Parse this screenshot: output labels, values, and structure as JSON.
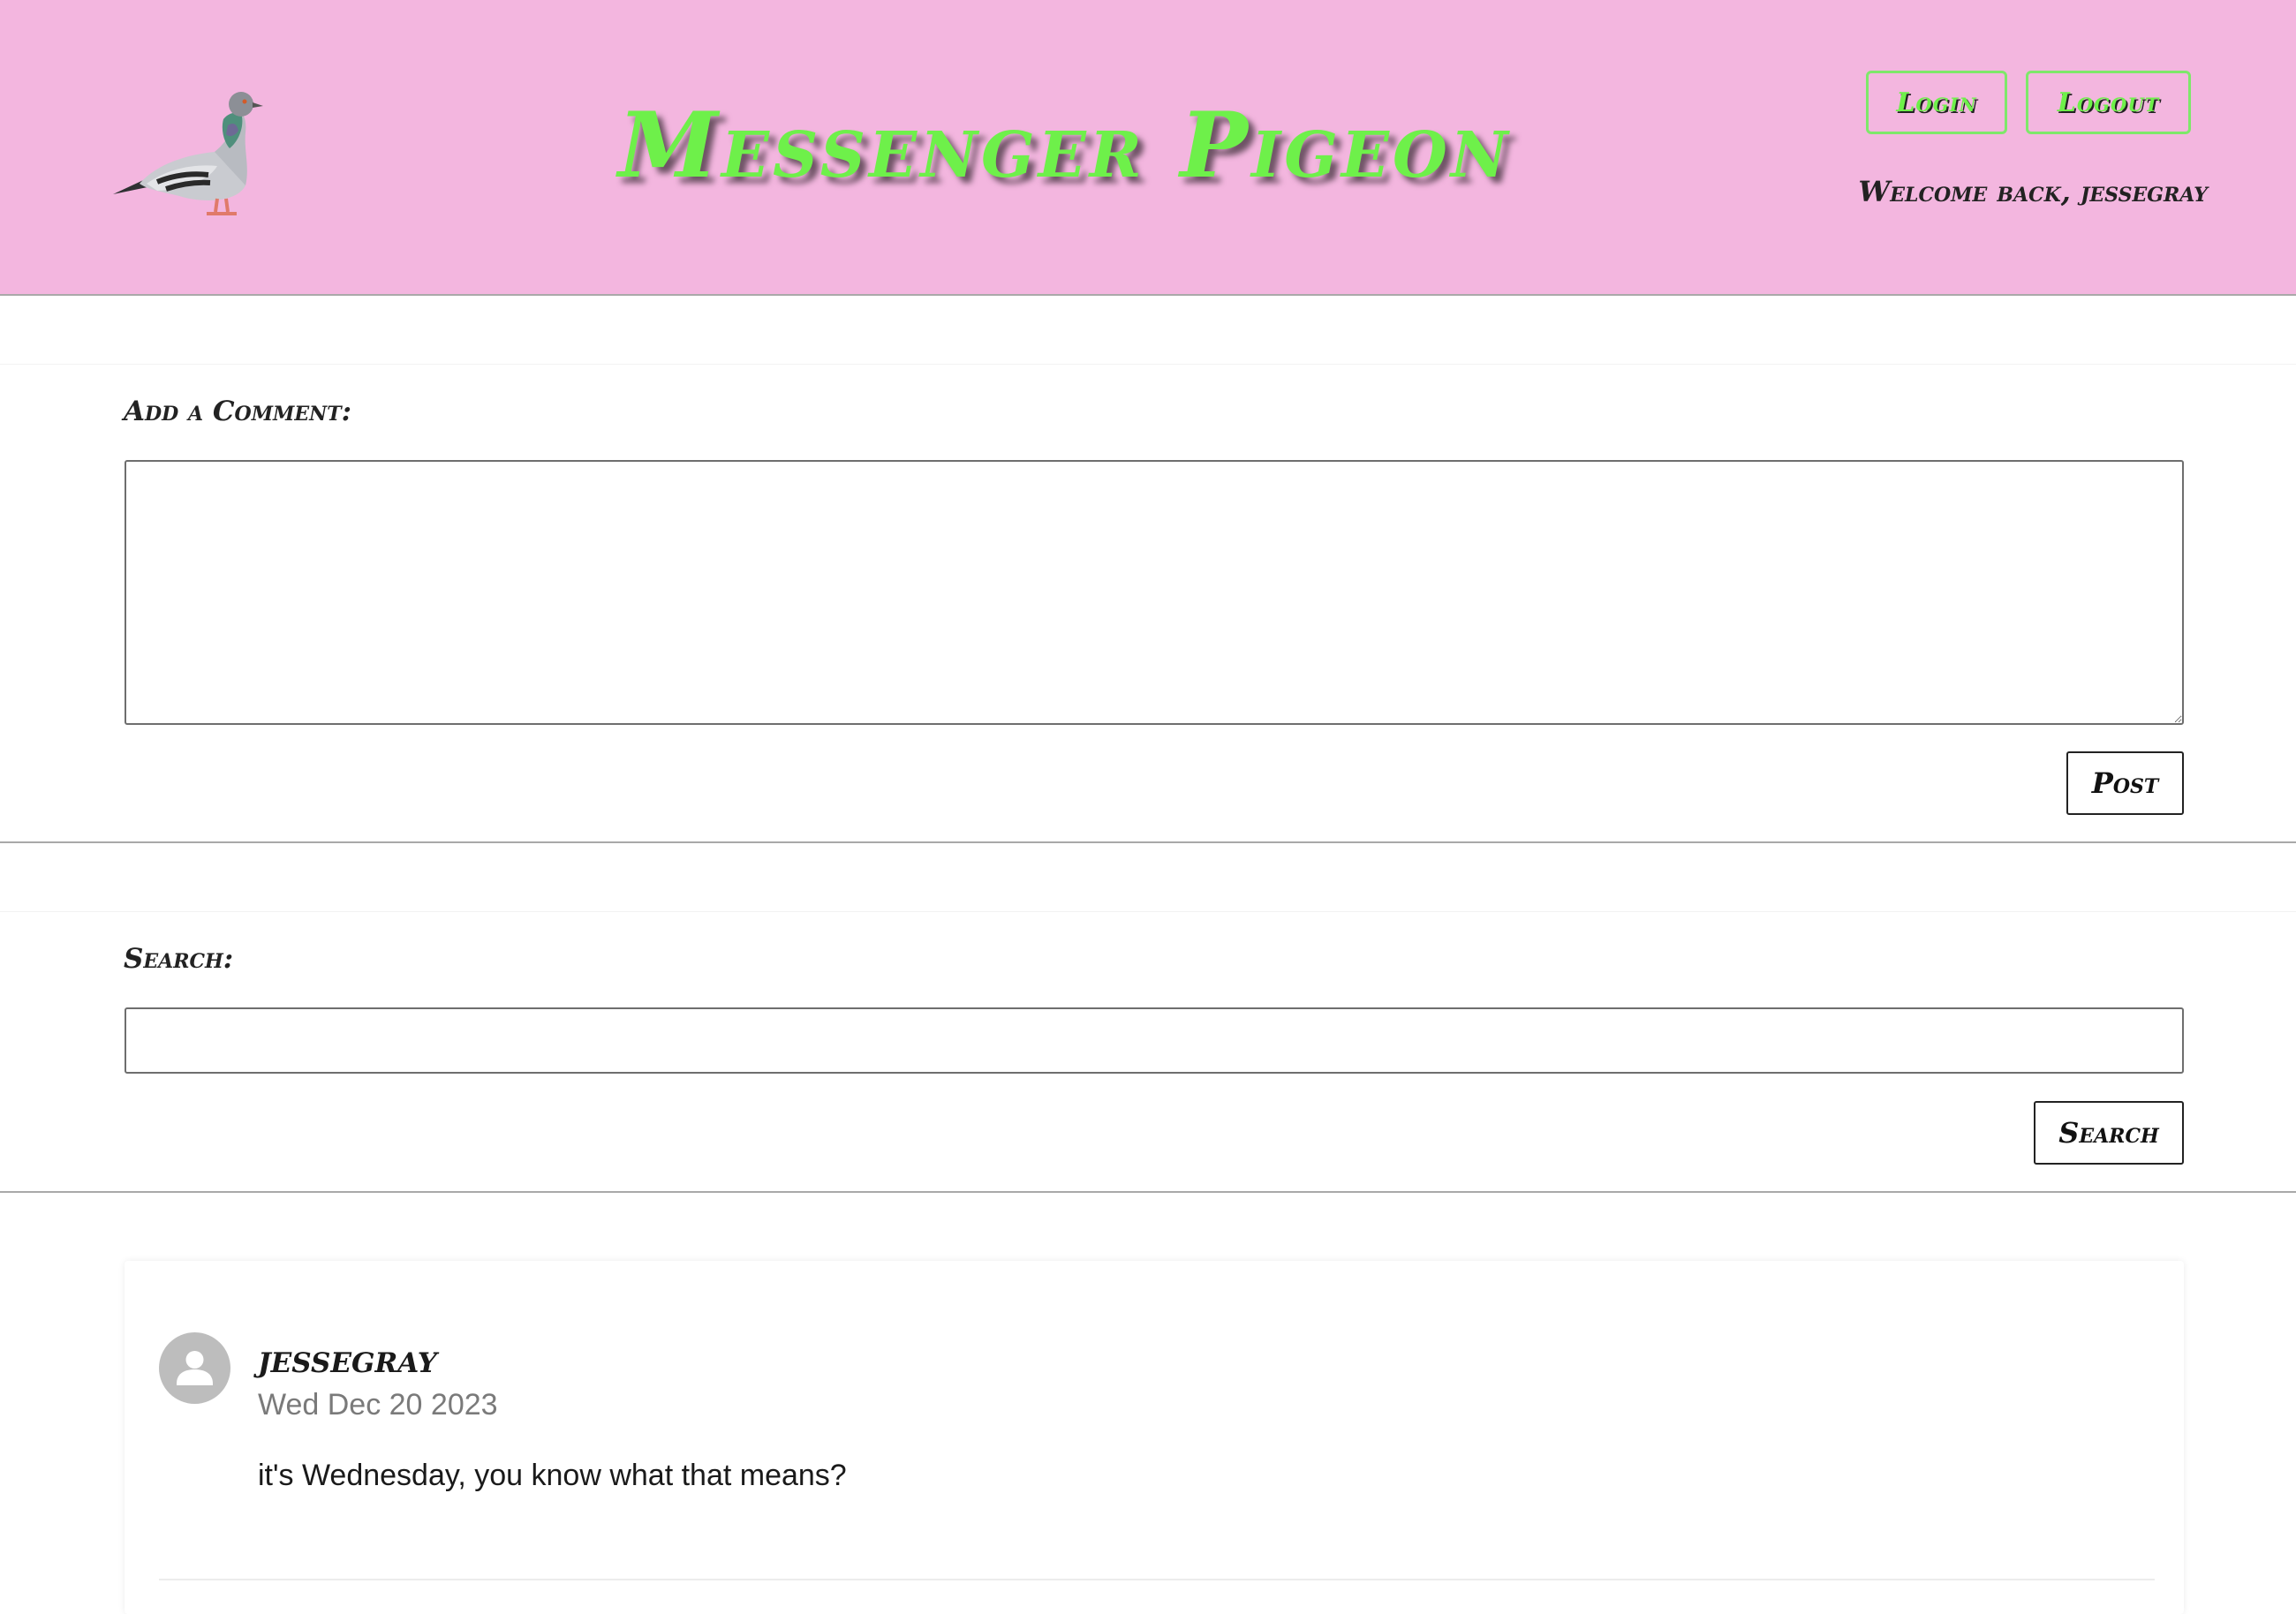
{
  "header": {
    "title": "Messenger Pigeon",
    "login_label": "Login",
    "logout_label": "Logout",
    "welcome_text": "Welcome back, jessegray",
    "logo_icon": "pigeon-icon"
  },
  "comment_form": {
    "label": "Add a Comment:",
    "value": "",
    "post_label": "Post"
  },
  "search_form": {
    "label": "Search:",
    "value": "",
    "search_label": "Search"
  },
  "comments": [
    {
      "username": "jessegray",
      "date": "Wed Dec 20 2023",
      "text": "it's Wednesday, you know what that means?",
      "avatar_icon": "user-avatar-icon"
    }
  ],
  "colors": {
    "header_bg": "#f3b6df",
    "title_green": "#6ef04a",
    "text_dark": "#222222",
    "date_gray": "#7a7a7a"
  }
}
